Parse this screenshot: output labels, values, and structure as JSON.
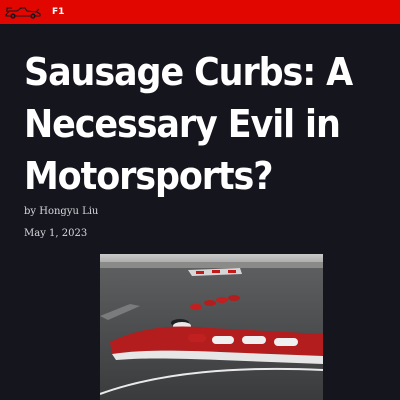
{
  "header": {
    "logo": "f1-car-logo-icon",
    "nav_label": "F1",
    "background_color": "#e10600"
  },
  "article": {
    "title": "Sausage Curbs: A\nNecessary Evil in\nMotorsports?",
    "byline": "by Hongyu Liu",
    "date": "May 1, 2023",
    "image": "race-track-sausage-curb-photo"
  },
  "colors": {
    "page_background": "#15151e",
    "text": "#ffffff"
  }
}
